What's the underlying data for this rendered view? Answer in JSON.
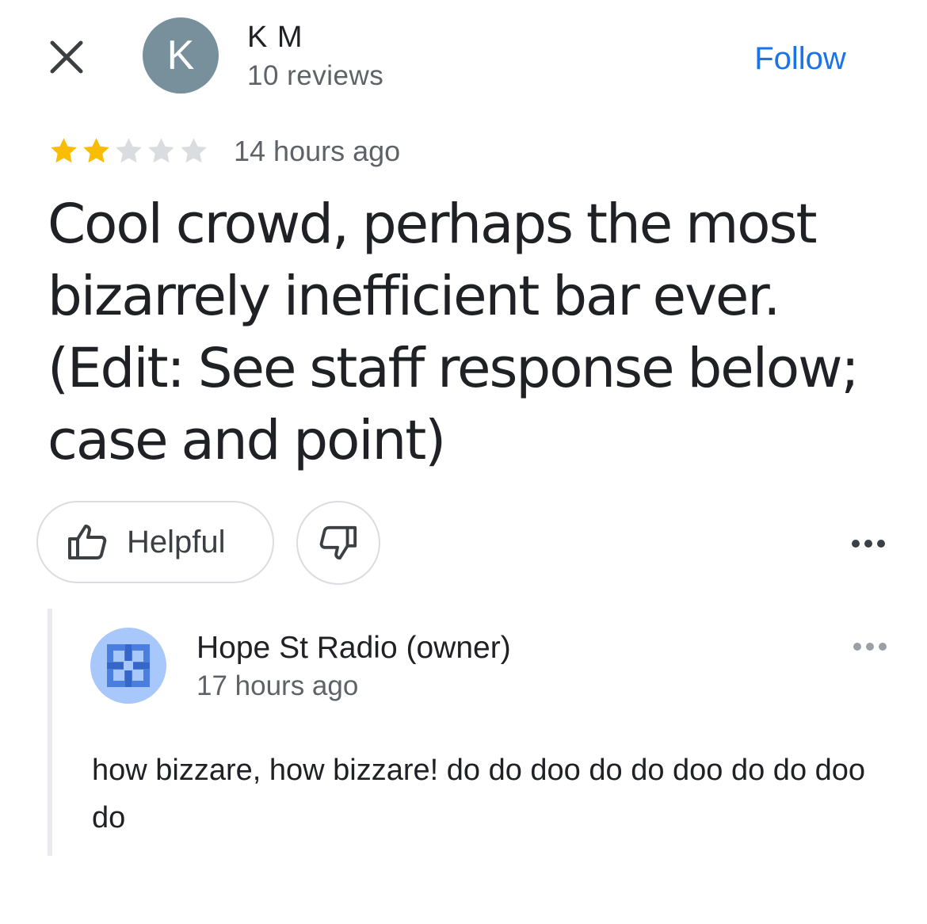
{
  "header": {
    "close_icon": "close-icon",
    "avatar_letter": "K",
    "avatar_color": "#78909c",
    "reviewer_name": "K M",
    "reviewer_reviews": "10 reviews",
    "follow_label": "Follow",
    "follow_color": "#1a73e8"
  },
  "review": {
    "rating": 2,
    "rating_max": 5,
    "star_filled_color": "#fbbc04",
    "star_empty_color": "#dadce0",
    "time_ago": "14 hours ago",
    "text": "Cool crowd, perhaps the most bizarrely inefficient bar ever. (Edit: See staff response below; case and point)"
  },
  "actions": {
    "helpful_label": "Helpful",
    "helpful_icon": "thumbs-up-icon",
    "unhelpful_icon": "thumbs-down-icon",
    "more_icon": "more-horizontal-icon"
  },
  "response": {
    "owner_name": "Hope St Radio (owner)",
    "time_ago": "17 hours ago",
    "text": "how bizzare, how bizzare! do do doo do do doo do do doo do",
    "avatar_icon": "business-icon",
    "avatar_color": "#a8c7fa",
    "more_icon": "more-horizontal-icon"
  }
}
